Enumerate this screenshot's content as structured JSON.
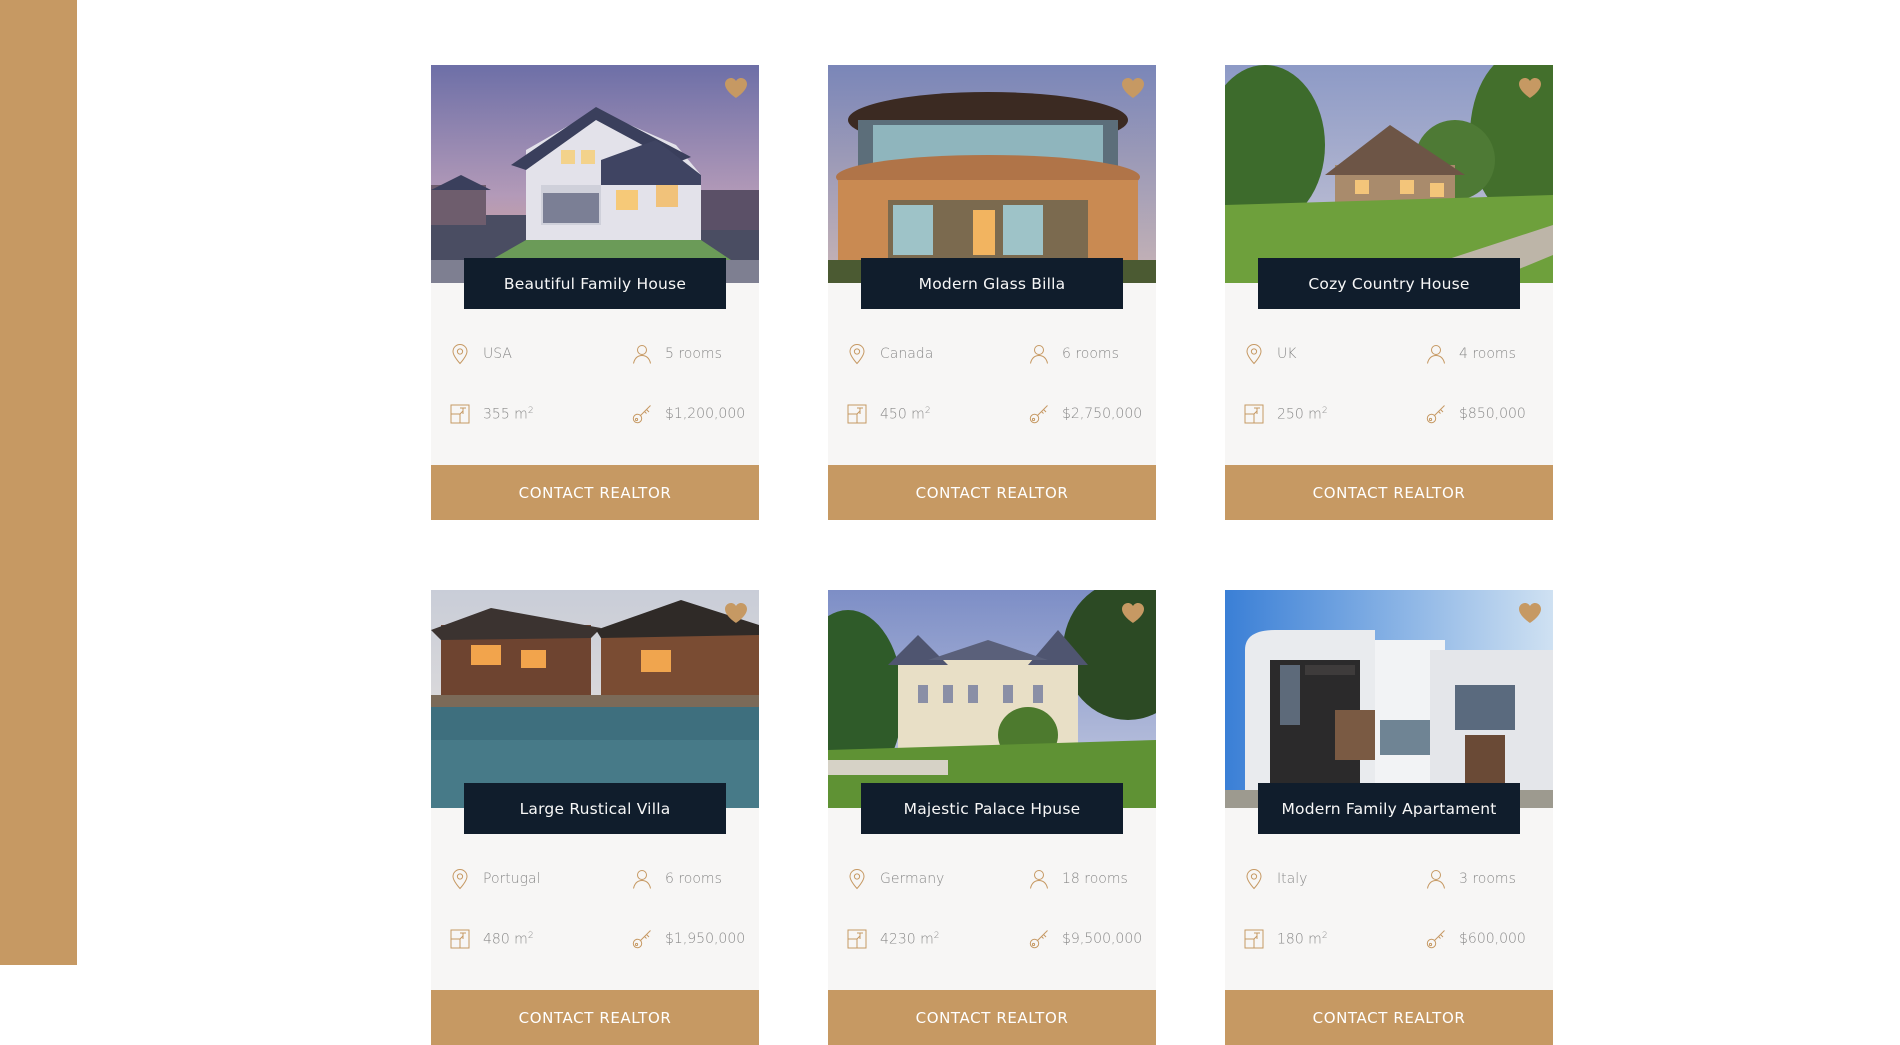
{
  "colors": {
    "accent": "#c69963",
    "dark": "#101d2c",
    "card_bg": "#f7f6f5",
    "text_muted": "#8a8a8a"
  },
  "icons": {
    "favorite": "heart-icon",
    "location": "map-pin-icon",
    "rooms": "user-icon",
    "area": "area-icon",
    "price": "key-icon"
  },
  "homes": [
    {
      "name": "Beautiful Family House",
      "location": "USA",
      "rooms": "5 rooms",
      "area": "355 m",
      "area_sup": "2",
      "price": "$1,200,000",
      "button": "CONTACT REALTOR"
    },
    {
      "name": "Modern Glass Billa",
      "location": "Canada",
      "rooms": "6 rooms",
      "area": "450 m",
      "area_sup": "2",
      "price": "$2,750,000",
      "button": "CONTACT REALTOR"
    },
    {
      "name": "Cozy Country House",
      "location": "UK",
      "rooms": "4 rooms",
      "area": "250 m",
      "area_sup": "2",
      "price": "$850,000",
      "button": "CONTACT REALTOR"
    },
    {
      "name": "Large Rustical Villa",
      "location": "Portugal",
      "rooms": "6 rooms",
      "area": "480 m",
      "area_sup": "2",
      "price": "$1,950,000",
      "button": "CONTACT REALTOR"
    },
    {
      "name": "Majestic Palace Hpuse",
      "location": "Germany",
      "rooms": "18 rooms",
      "area": "4230 m",
      "area_sup": "2",
      "price": "$9,500,000",
      "button": "CONTACT REALTOR"
    },
    {
      "name": "Modern Family Apartament",
      "location": "Italy",
      "rooms": "3 rooms",
      "area": "180 m",
      "area_sup": "2",
      "price": "$600,000",
      "button": "CONTACT REALTOR"
    }
  ]
}
